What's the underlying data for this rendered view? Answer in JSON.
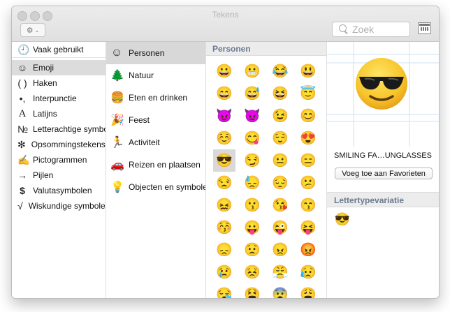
{
  "window": {
    "title": "Tekens"
  },
  "search": {
    "placeholder": "Zoek"
  },
  "categories": [
    {
      "icon": "🕘",
      "icon_name": "clock-icon",
      "label": "Vaak gebruikt"
    },
    {
      "icon": "☺",
      "icon_name": "smiley-icon",
      "label": "Emoji"
    },
    {
      "icon": "( )",
      "icon_name": "parentheses-icon",
      "label": "Haken"
    },
    {
      "icon": "•,",
      "icon_name": "punctuation-icon",
      "label": "Interpunctie"
    },
    {
      "icon": "A",
      "icon_name": "latin-letter-icon",
      "label": "Latijns"
    },
    {
      "icon": "№",
      "icon_name": "numero-sign-icon",
      "label": "Letterachtige symbolen"
    },
    {
      "icon": "✻",
      "icon_name": "bullet-asterisk-icon",
      "label": "Opsommingstekens/sterren"
    },
    {
      "icon": "✍",
      "icon_name": "pictogram-icon",
      "label": "Pictogrammen"
    },
    {
      "icon": "→",
      "icon_name": "arrow-icon",
      "label": "Pijlen"
    },
    {
      "icon": "$",
      "icon_name": "dollar-icon",
      "label": "Valutasymbolen"
    },
    {
      "icon": "√",
      "icon_name": "square-root-icon",
      "label": "Wiskundige symbolen"
    }
  ],
  "subcategories": [
    {
      "icon": "☺",
      "icon_name": "smiley-icon",
      "label": "Personen"
    },
    {
      "icon": "🌲",
      "icon_name": "tree-icon",
      "label": "Natuur"
    },
    {
      "icon": "🍔",
      "icon_name": "food-icon",
      "label": "Eten en drinken"
    },
    {
      "icon": "🎉",
      "icon_name": "party-popper-icon",
      "label": "Feest"
    },
    {
      "icon": "🏃",
      "icon_name": "runner-icon",
      "label": "Activiteit"
    },
    {
      "icon": "🚗",
      "icon_name": "car-icon",
      "label": "Reizen en plaatsen"
    },
    {
      "icon": "💡",
      "icon_name": "objects-icon",
      "label": "Objecten en symbolen"
    }
  ],
  "grid": {
    "header": "Personen",
    "emojis": [
      "😀",
      "😬",
      "😂",
      "😃",
      "😄",
      "😅",
      "😆",
      "😇",
      "😈",
      "👿",
      "😉",
      "😊",
      "☺️",
      "😋",
      "😌",
      "😍",
      "😎",
      "😏",
      "😐",
      "😑",
      "😒",
      "😓",
      "😔",
      "😕",
      "😖",
      "😗",
      "😘",
      "😙",
      "😚",
      "😛",
      "😜",
      "😝",
      "😞",
      "😟",
      "😠",
      "😡",
      "😢",
      "😣",
      "😤",
      "😥",
      "😪",
      "😫",
      "😨",
      "😩"
    ]
  },
  "detail": {
    "preview_emoji": "😎",
    "name": "SMILING FA…UNGLASSES",
    "fav_button": "Voeg toe aan Favorieten",
    "variant_header": "Lettertypevariatie",
    "variant_emoji": "😎"
  },
  "colors": {
    "face": "#f7c52a",
    "face_edge": "#e9a21a",
    "selection": "#d9d9d9",
    "section_header_text": "#6b7a8f"
  }
}
